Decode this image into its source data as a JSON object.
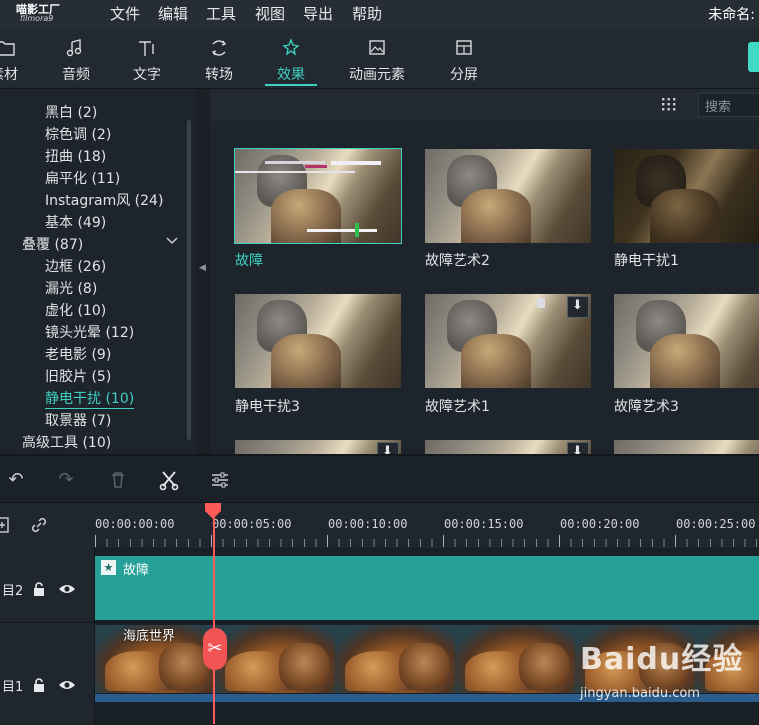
{
  "app": {
    "logo_cn": "喵影工厂",
    "logo_en": "filmora9",
    "project_title": "未命名:"
  },
  "menu": [
    "文件",
    "编辑",
    "工具",
    "视图",
    "导出",
    "帮助"
  ],
  "tabs": [
    {
      "label": "素材",
      "icon": "folder-icon"
    },
    {
      "label": "音频",
      "icon": "music-note-icon"
    },
    {
      "label": "文字",
      "icon": "text-icon"
    },
    {
      "label": "转场",
      "icon": "transition-icon"
    },
    {
      "label": "效果",
      "icon": "effects-icon",
      "active": true
    },
    {
      "label": "动画元素",
      "icon": "image-icon"
    },
    {
      "label": "分屏",
      "icon": "split-screen-icon"
    }
  ],
  "categories": [
    {
      "label": "黑白 (2)"
    },
    {
      "label": "棕色调 (2)"
    },
    {
      "label": "扭曲 (18)"
    },
    {
      "label": "扁平化 (11)"
    },
    {
      "label": "Instagram风 (24)"
    },
    {
      "label": "基本 (49)"
    },
    {
      "label": "叠覆 (87)",
      "expanded": true
    },
    {
      "label": "边框 (26)"
    },
    {
      "label": "漏光 (8)"
    },
    {
      "label": "虚化 (10)"
    },
    {
      "label": "镜头光晕 (12)"
    },
    {
      "label": "老电影 (9)"
    },
    {
      "label": "旧胶片 (5)"
    },
    {
      "label": "静电干扰 (10)",
      "active": true
    },
    {
      "label": "取景器 (7)"
    },
    {
      "label": "高级工具 (10)"
    }
  ],
  "search": {
    "placeholder": "搜索"
  },
  "effects": [
    {
      "label": "故障",
      "selected": true
    },
    {
      "label": "故障艺术2"
    },
    {
      "label": "静电干扰1"
    },
    {
      "label": "静电干扰3"
    },
    {
      "label": "故障艺术1",
      "downloadable": true
    },
    {
      "label": "故障艺术3"
    }
  ],
  "timeline": {
    "timecodes": [
      "00:00:00:00",
      "00:00:05:00",
      "00:00:10:00",
      "00:00:15:00",
      "00:00:20:00",
      "00:00:25:00"
    ],
    "tracks": [
      {
        "number": "2",
        "clip": "故障"
      },
      {
        "number": "1",
        "clip": "海底世界"
      }
    ]
  },
  "watermark": {
    "brand": "Baidu经验",
    "url": "jingyan.baidu.com"
  },
  "colors": {
    "accent": "#3ed0c0",
    "playhead": "#ff5a5a",
    "effect_clip": "#26a199"
  }
}
